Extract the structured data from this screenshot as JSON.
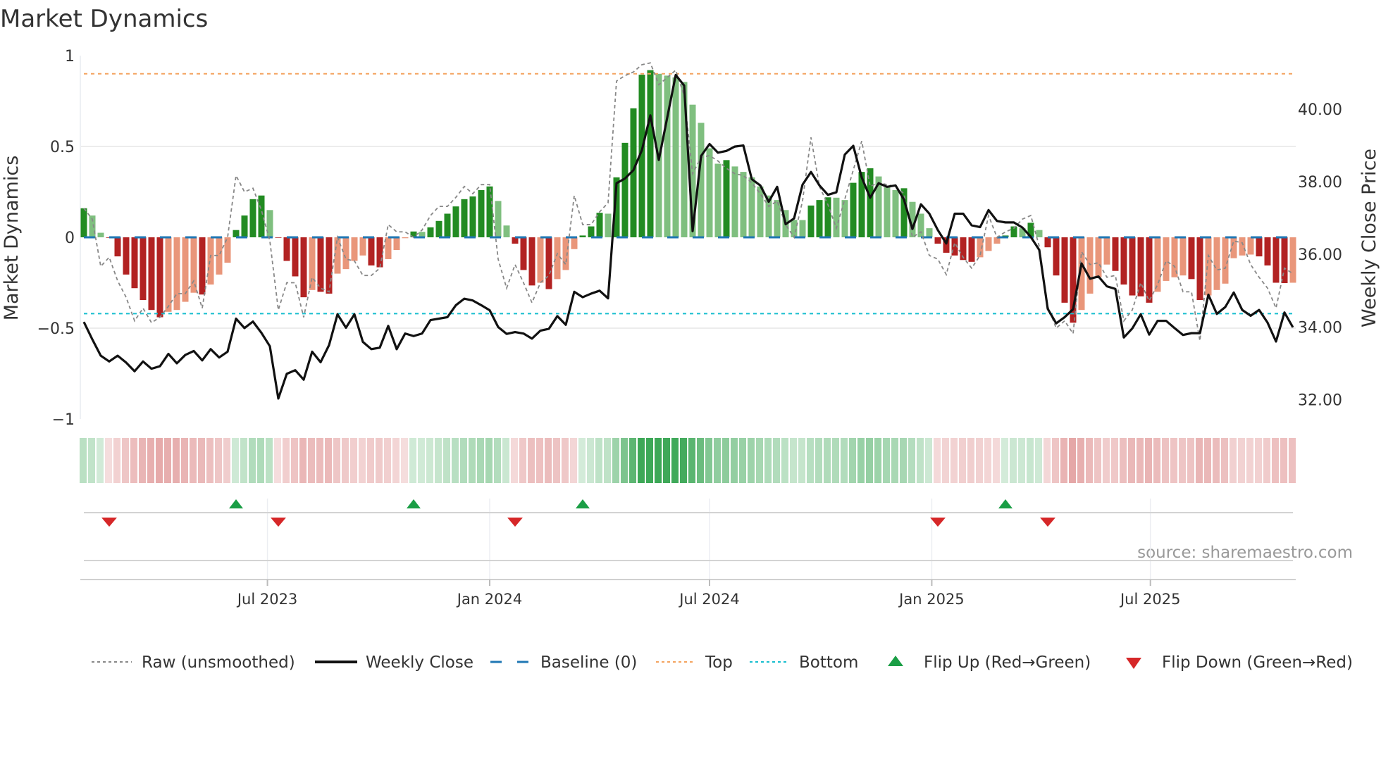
{
  "chart_data": {
    "type": "bar",
    "title": "Market Dynamics",
    "ylabel": "Market Dynamics",
    "y2label": "Weekly Close Price",
    "ylim": [
      -1,
      1
    ],
    "y2lim": [
      31,
      41.5
    ],
    "yticks": [
      {
        "v": 1,
        "label": "1"
      },
      {
        "v": 0.5,
        "label": "0.5"
      },
      {
        "v": 0,
        "label": "0"
      },
      {
        "v": -0.5,
        "label": "−0.5"
      },
      {
        "v": -1,
        "label": "−1"
      }
    ],
    "y2ticks": [
      {
        "v": 40,
        "label": "40.00"
      },
      {
        "v": 38,
        "label": "38.00"
      },
      {
        "v": 36,
        "label": "36.00"
      },
      {
        "v": 34,
        "label": "34.00"
      },
      {
        "v": 32,
        "label": "32.00"
      }
    ],
    "xticks": [
      {
        "date": "2023-07-01",
        "label": "Jul 2023"
      },
      {
        "date": "2024-01-01",
        "label": "Jan 2024"
      },
      {
        "date": "2024-07-01",
        "label": "Jul 2024"
      },
      {
        "date": "2025-01-01",
        "label": "Jan 2025"
      },
      {
        "date": "2025-07-01",
        "label": "Jul 2025"
      }
    ],
    "start_week": "2023-01-30",
    "frequency": "weekly",
    "top_level": 0.9,
    "bottom_level": -0.42,
    "baseline": 0,
    "smoothed": [
      0.16,
      0.12,
      0.025,
      -0.003,
      -0.105,
      -0.205,
      -0.28,
      -0.345,
      -0.4,
      -0.44,
      -0.41,
      -0.4,
      -0.355,
      -0.305,
      -0.315,
      -0.26,
      -0.205,
      -0.14,
      0.04,
      0.12,
      0.21,
      0.23,
      0.15,
      -0.003,
      -0.13,
      -0.215,
      -0.33,
      -0.29,
      -0.3,
      -0.31,
      -0.2,
      -0.175,
      -0.13,
      -0.1,
      -0.155,
      -0.165,
      -0.12,
      -0.07,
      -0.005,
      0.032,
      0.03,
      0.055,
      0.09,
      0.13,
      0.17,
      0.21,
      0.225,
      0.26,
      0.28,
      0.2,
      0.065,
      -0.035,
      -0.18,
      -0.265,
      -0.25,
      -0.285,
      -0.23,
      -0.18,
      -0.065,
      0.01,
      0.06,
      0.135,
      0.13,
      0.33,
      0.52,
      0.71,
      0.895,
      0.92,
      0.9,
      0.89,
      0.88,
      0.855,
      0.73,
      0.63,
      0.49,
      0.405,
      0.425,
      0.39,
      0.36,
      0.33,
      0.28,
      0.23,
      0.205,
      0.15,
      0.096,
      0.095,
      0.175,
      0.205,
      0.22,
      0.218,
      0.205,
      0.3,
      0.36,
      0.38,
      0.335,
      0.275,
      0.26,
      0.27,
      0.195,
      0.13,
      0.05,
      -0.035,
      -0.085,
      -0.1,
      -0.125,
      -0.135,
      -0.11,
      -0.075,
      -0.035,
      0.01,
      0.06,
      0.05,
      0.08,
      0.04,
      -0.055,
      -0.21,
      -0.36,
      -0.47,
      -0.4,
      -0.31,
      -0.22,
      -0.15,
      -0.185,
      -0.26,
      -0.32,
      -0.325,
      -0.36,
      -0.3,
      -0.24,
      -0.22,
      -0.21,
      -0.23,
      -0.345,
      -0.32,
      -0.29,
      -0.255,
      -0.115,
      -0.1,
      -0.095,
      -0.105,
      -0.155,
      -0.25,
      -0.252,
      -0.25
    ],
    "raw": [
      0.16,
      0.1,
      -0.16,
      -0.11,
      -0.24,
      -0.33,
      -0.46,
      -0.39,
      -0.47,
      -0.44,
      -0.38,
      -0.31,
      -0.31,
      -0.24,
      -0.39,
      -0.1,
      -0.1,
      0.0,
      0.34,
      0.25,
      0.27,
      0.15,
      -0.02,
      -0.4,
      -0.25,
      -0.25,
      -0.44,
      -0.22,
      -0.28,
      -0.3,
      0.0,
      -0.12,
      -0.13,
      -0.21,
      -0.21,
      -0.17,
      0.07,
      0.03,
      0.03,
      0.0,
      0.04,
      0.12,
      0.17,
      0.17,
      0.22,
      0.28,
      0.24,
      0.29,
      0.29,
      -0.12,
      -0.28,
      -0.15,
      -0.25,
      -0.36,
      -0.25,
      -0.21,
      -0.09,
      -0.15,
      0.23,
      0.07,
      0.07,
      0.14,
      0.19,
      0.86,
      0.89,
      0.91,
      0.95,
      0.96,
      0.84,
      0.88,
      0.92,
      0.78,
      0.35,
      0.44,
      0.45,
      0.42,
      0.38,
      0.35,
      0.34,
      0.3,
      0.24,
      0.17,
      0.2,
      0.07,
      0.0,
      0.2,
      0.55,
      0.28,
      0.18,
      0.05,
      0.21,
      0.37,
      0.53,
      0.28,
      0.3,
      0.29,
      0.28,
      0.24,
      0.0,
      0.03,
      -0.1,
      -0.12,
      -0.205,
      -0.03,
      -0.11,
      -0.17,
      -0.1,
      0.12,
      0.0,
      0.03,
      0.05,
      0.1,
      0.12,
      -0.05,
      -0.38,
      -0.5,
      -0.46,
      -0.53,
      -0.08,
      -0.15,
      -0.14,
      -0.22,
      -0.21,
      -0.46,
      -0.4,
      -0.25,
      -0.35,
      -0.26,
      -0.13,
      -0.16,
      -0.3,
      -0.3,
      -0.57,
      -0.1,
      -0.18,
      -0.17,
      -0.02,
      -0.03,
      -0.15,
      -0.22,
      -0.28,
      -0.39,
      -0.17,
      -0.2
    ],
    "weekly_close": [
      34.14,
      33.66,
      33.21,
      33.05,
      33.21,
      33.02,
      32.78,
      33.05,
      32.85,
      32.92,
      33.26,
      33.0,
      33.23,
      33.34,
      33.08,
      33.39,
      33.16,
      33.32,
      34.23,
      33.97,
      34.15,
      33.84,
      33.47,
      32.03,
      32.71,
      32.81,
      32.55,
      33.32,
      33.03,
      33.5,
      34.35,
      33.98,
      34.35,
      33.59,
      33.39,
      33.43,
      34.03,
      33.39,
      33.82,
      33.75,
      33.82,
      34.19,
      34.23,
      34.27,
      34.6,
      34.78,
      34.73,
      34.6,
      34.46,
      34.0,
      33.81,
      33.86,
      33.82,
      33.68,
      33.9,
      33.95,
      34.3,
      34.06,
      34.97,
      34.82,
      34.92,
      35.0,
      34.79,
      37.96,
      38.09,
      38.32,
      38.87,
      39.83,
      38.6,
      39.77,
      40.94,
      40.65,
      36.64,
      38.71,
      39.04,
      38.8,
      38.85,
      38.97,
      39.0,
      38.07,
      37.9,
      37.45,
      37.86,
      36.83,
      36.99,
      37.92,
      38.27,
      37.9,
      37.64,
      37.71,
      38.75,
      38.99,
      38.12,
      37.56,
      37.96,
      37.86,
      37.9,
      37.51,
      36.7,
      37.38,
      37.12,
      36.67,
      36.3,
      37.12,
      37.12,
      36.8,
      36.75,
      37.22,
      36.92,
      36.88,
      36.88,
      36.74,
      36.48,
      36.12,
      34.5,
      34.1,
      34.27,
      34.49,
      35.75,
      35.33,
      35.39,
      35.12,
      35.05,
      33.71,
      33.96,
      34.35,
      33.79,
      34.17,
      34.17,
      33.97,
      33.78,
      33.83,
      33.83,
      34.89,
      34.36,
      34.55,
      34.95,
      34.47,
      34.31,
      34.47,
      34.12,
      33.6,
      34.4,
      33.99
    ],
    "flip_up_weeks": [
      19,
      40,
      60,
      110
    ],
    "flip_down_weeks": [
      4,
      24,
      52,
      102,
      115
    ],
    "legend": {
      "position": "bottom",
      "items": [
        "Raw (unsmoothed)",
        "Weekly Close",
        "Baseline (0)",
        "Top",
        "Bottom",
        "Flip Up (Red→Green)",
        "Flip Down (Green→Red)"
      ]
    },
    "source": "source: sharemaestro.com",
    "colors": {
      "pos_strong": "#228b22",
      "pos_weak": "#7fbf7f",
      "neg_strong": "#b22222",
      "neg_weak": "#e9967a",
      "raw": "#888888",
      "close": "#111111",
      "baseline": "#1f77b4",
      "top": "#f4a460",
      "bottom": "#17becf",
      "flip_up": "#1a9e45",
      "flip_down": "#d62728",
      "strip_pos": "#2ca048",
      "strip_neg": "#c84444"
    }
  }
}
